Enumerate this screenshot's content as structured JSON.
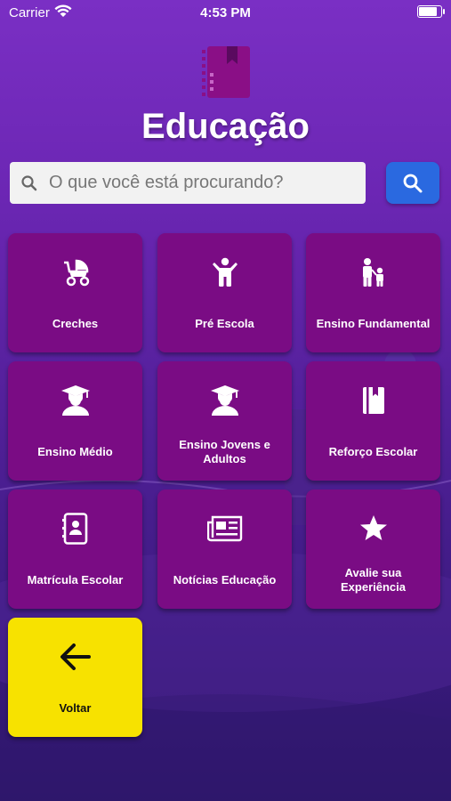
{
  "status_bar": {
    "carrier": "Carrier",
    "time": "4:53 PM"
  },
  "header": {
    "title": "Educação",
    "logo_icon": "notebook-icon"
  },
  "search": {
    "placeholder": "O que você está procurando?",
    "value": ""
  },
  "menu": [
    {
      "label": "Creches",
      "icon": "stroller-icon"
    },
    {
      "label": "Pré Escola",
      "icon": "child-icon"
    },
    {
      "label": "Ensino Fundamental",
      "icon": "parent-child-icon"
    },
    {
      "label": "Ensino Médio",
      "icon": "graduate-icon"
    },
    {
      "label": "Ensino Jovens e Adultos",
      "icon": "graduate-icon"
    },
    {
      "label": "Reforço Escolar",
      "icon": "book-icon"
    },
    {
      "label": "Matrícula Escolar",
      "icon": "contacts-book-icon"
    },
    {
      "label": "Notícias Educação",
      "icon": "newspaper-icon"
    },
    {
      "label": "Avalie sua Experiência",
      "icon": "star-icon"
    }
  ],
  "back": {
    "label": "Voltar",
    "icon": "arrow-left-icon"
  },
  "colors": {
    "tile": "#7a0c84",
    "back_tile": "#f7e200",
    "search_button": "#2a69e0",
    "background": "#6b26b3"
  }
}
